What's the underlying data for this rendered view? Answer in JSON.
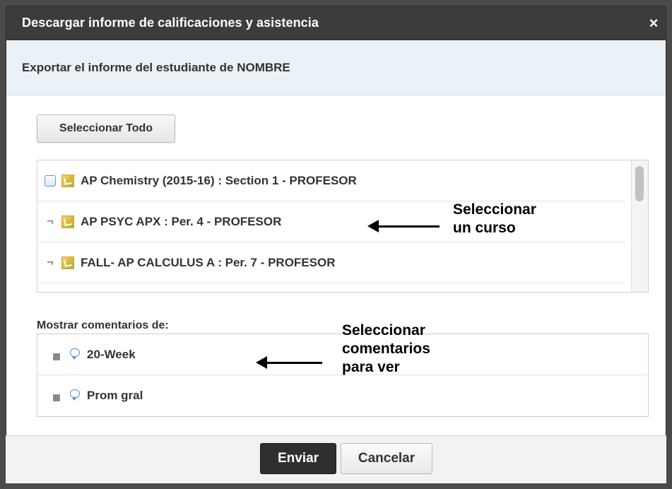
{
  "dialog": {
    "title": "Descargar informe de calificaciones y asistencia",
    "close_glyph": "×",
    "subtitle_prefix": "Exportar el informe del estudiante de",
    "student_name": "NOMBRE"
  },
  "buttons": {
    "select_all": "Seleccionar Todo",
    "submit": "Enviar",
    "cancel": "Cancelar"
  },
  "courses": [
    {
      "label": "AP Chemistry (2015-16) : Section 1 - PROFESOR",
      "checkbox": "box"
    },
    {
      "label": "AP PSYC APX : Per. 4 - PROFESOR",
      "checkbox": "dash"
    },
    {
      "label": "FALL- AP CALCULUS A : Per. 7 - PROFESOR",
      "checkbox": "dash"
    }
  ],
  "comments": {
    "label": "Mostrar comentarios de:",
    "items": [
      {
        "label": "20-Week"
      },
      {
        "label": "Prom gral"
      }
    ]
  },
  "annotations": {
    "course_hint_line1": "Seleccionar",
    "course_hint_line2": "un curso",
    "comments_hint_line1": "Seleccionar",
    "comments_hint_line2": "comentarios",
    "comments_hint_line3": "para ver"
  },
  "icons": {
    "course": "course-icon",
    "comment": "comment-bubble-icon",
    "close": "close-icon"
  },
  "colors": {
    "titlebar": "#3c3c3c",
    "subhead_bg": "#eaf1f7",
    "submit_bg": "#2f2f2f",
    "comment_icon": "#5a8fd6"
  }
}
